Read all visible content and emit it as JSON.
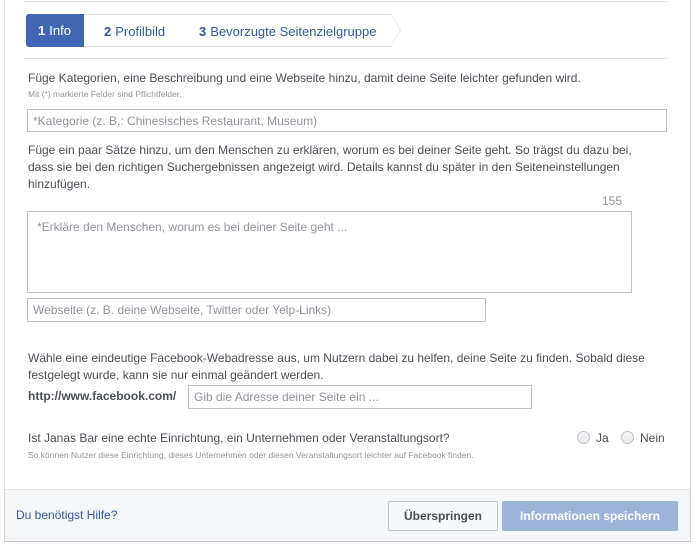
{
  "steps": [
    {
      "num": "1",
      "label": "Info"
    },
    {
      "num": "2",
      "label": "Profilbild"
    },
    {
      "num": "3",
      "label": "Bevorzugte Seitenzielgruppe"
    }
  ],
  "info": {
    "intro": "Füge Kategorien, eine Beschreibung und eine Webseite hinzu, damit deine Seite leichter gefunden wird.",
    "required_note": "Mit (*) markierte Felder sind Pflichtfelder.",
    "category_placeholder": "*Kategorie (z. B.: Chinesisches Restaurant, Museum)",
    "description_text": "Füge ein paar Sätze hinzu, um den Menschen zu erklären, worum es bei deiner Seite geht. So trägst du dazu bei, dass sie bei den richtigen Suchergebnissen angezeigt wird. Details kannst du später in den Seiteneinstellungen hinzufügen.",
    "char_counter": "155",
    "description_placeholder": "*Erkläre den Menschen, worum es bei deiner Seite geht ...",
    "website_placeholder": "Webseite (z. B. deine Webseite, Twitter oder Yelp-Links)",
    "fb_text": "Wähle eine eindeutige Facebook-Webadresse aus, um Nutzern dabei zu helfen, deine Seite zu finden. Sobald diese festgelegt wurde, kann sie nur einmal geändert werden.",
    "fb_prefix": "http://www.facebook.com/",
    "fb_placeholder": "Gib die Adresse deiner Seite ein ...",
    "question": "Ist Janas Bar eine echte Einrichtung, ein Unternehmen oder Veranstaltungsort?",
    "question_hint": "So können Nutzer diese Einrichtung, dieses Unternehmen oder diesen Veranstaltungsort leichter auf Facebook finden.",
    "option_yes": "Ja",
    "option_no": "Nein"
  },
  "footer": {
    "help_link": "Du benötigst Hilfe?",
    "skip_label": "Überspringen",
    "save_label": "Informationen speichern"
  },
  "colors": {
    "accent": "#4267b2",
    "link": "#365899",
    "save_disabled": "#9cb4d8"
  }
}
